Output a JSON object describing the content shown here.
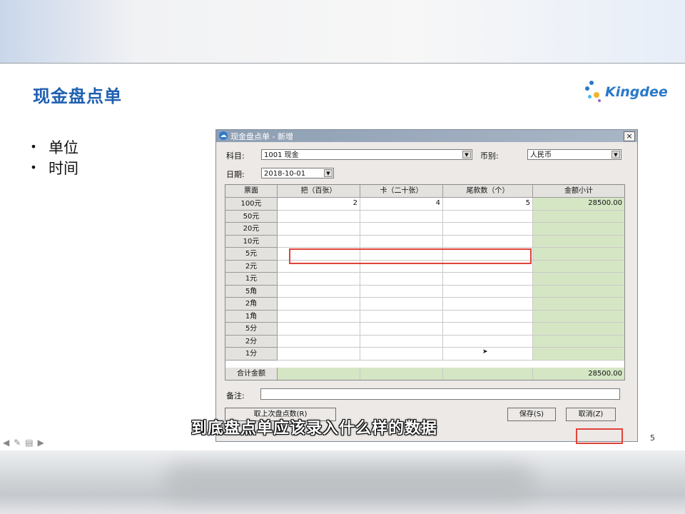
{
  "slide": {
    "title": "现金盘点单",
    "logo_text": "Kingdee",
    "bullets": [
      "单位",
      "时间"
    ],
    "page_number": "5"
  },
  "dialog": {
    "title": "现金盘点单 - 新增",
    "close_label": "×",
    "subject_label": "科目:",
    "subject_value": "1001 现金",
    "currency_label": "币别:",
    "currency_value": "人民币",
    "date_label": "日期:",
    "date_value": "2018-10-01",
    "columns": [
      "票面",
      "把（百张）",
      "卡（二十张）",
      "尾款数（个）",
      "金额小计"
    ],
    "rows": [
      {
        "denom": "100元",
        "ba": "2",
        "ka": "4",
        "wei": "5",
        "subtotal": "28500.00"
      },
      {
        "denom": "50元",
        "ba": "",
        "ka": "",
        "wei": "",
        "subtotal": ""
      },
      {
        "denom": "20元",
        "ba": "",
        "ka": "",
        "wei": "",
        "subtotal": ""
      },
      {
        "denom": "10元",
        "ba": "",
        "ka": "",
        "wei": "",
        "subtotal": ""
      },
      {
        "denom": "5元",
        "ba": "",
        "ka": "",
        "wei": "",
        "subtotal": ""
      },
      {
        "denom": "2元",
        "ba": "",
        "ka": "",
        "wei": "",
        "subtotal": ""
      },
      {
        "denom": "1元",
        "ba": "",
        "ka": "",
        "wei": "",
        "subtotal": ""
      },
      {
        "denom": "5角",
        "ba": "",
        "ka": "",
        "wei": "",
        "subtotal": ""
      },
      {
        "denom": "2角",
        "ba": "",
        "ka": "",
        "wei": "",
        "subtotal": ""
      },
      {
        "denom": "1角",
        "ba": "",
        "ka": "",
        "wei": "",
        "subtotal": ""
      },
      {
        "denom": "5分",
        "ba": "",
        "ka": "",
        "wei": "",
        "subtotal": ""
      },
      {
        "denom": "2分",
        "ba": "",
        "ka": "",
        "wei": "",
        "subtotal": ""
      },
      {
        "denom": "1分",
        "ba": "",
        "ka": "",
        "wei": "",
        "subtotal": ""
      }
    ],
    "total_label": "合计金额",
    "total_value": "28500.00",
    "remark_label": "备注:",
    "load_button": "取上次盘点数(R)",
    "save_button": "保存(S)",
    "cancel_button": "取消(Z)"
  },
  "caption": "到底盘点单应该录入什么样的数据",
  "colors": {
    "title_blue": "#1f5fb0",
    "highlight_red": "#e0433a",
    "total_green": "#d5e6c4"
  }
}
